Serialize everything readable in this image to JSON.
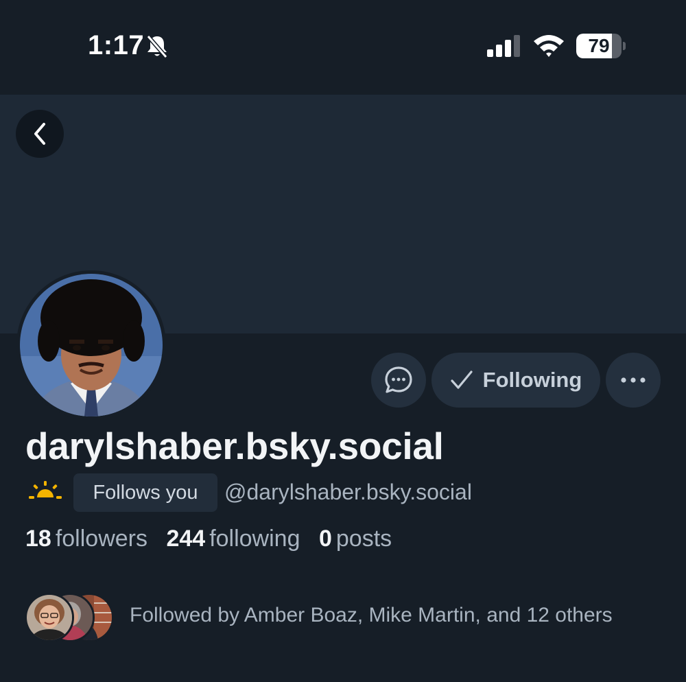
{
  "status_bar": {
    "time": "1:17",
    "battery_level": "79",
    "battery_fraction": 0.79
  },
  "profile": {
    "display_name": "darylshaber.bsky.social",
    "follows_you_label": "Follows you",
    "handle": "@darylshaber.bsky.social",
    "following_button_label": "Following",
    "stats": {
      "followers_count": "18",
      "followers_label": "followers",
      "following_count": "244",
      "following_label": "following",
      "posts_count": "0",
      "posts_label": "posts"
    },
    "known_followers_text": "Followed by Amber Boaz, Mike Martin, and 12 others"
  },
  "icons": {
    "back": "chevron-left-icon",
    "mute": "bell-slash-icon",
    "message": "chat-bubble-icon",
    "following": "checkmark-icon",
    "more": "ellipsis-icon",
    "status_emoji": "sunrise-icon"
  },
  "colors": {
    "background": "#161e27",
    "banner": "#1e2936",
    "button_bg": "#24303e",
    "secondary_text": "#a9b4c0",
    "sun": "#f5b400"
  }
}
